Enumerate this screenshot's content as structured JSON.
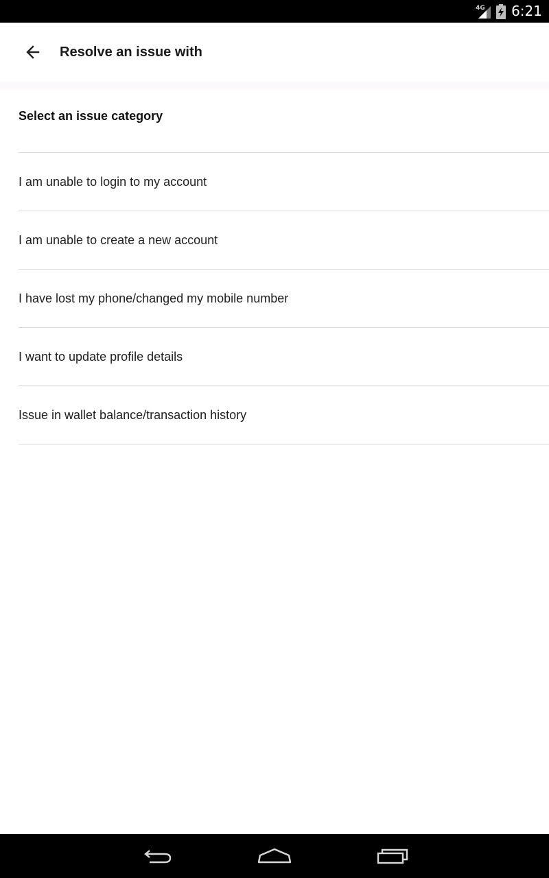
{
  "status_bar": {
    "network": "4G",
    "time": "6:21",
    "icons": [
      "signal-icon",
      "battery-charging-icon"
    ]
  },
  "app_bar": {
    "back_icon": "arrow-left-icon",
    "title": "Resolve an issue with"
  },
  "content": {
    "section_title": "Select an issue category",
    "issues": [
      {
        "label": "I am unable to login to my account"
      },
      {
        "label": "I am unable to create a new account"
      },
      {
        "label": "I have lost my phone/changed my mobile number"
      },
      {
        "label": "I want to update profile details"
      },
      {
        "label": "Issue in wallet balance/transaction history"
      }
    ]
  },
  "nav_bar": {
    "icons": [
      "nav-back-icon",
      "nav-home-icon",
      "nav-recents-icon"
    ]
  },
  "colors": {
    "status_bar_bg": "#000000",
    "background": "#ffffff",
    "divider": "#d9d9d9",
    "text": "#1f1f1f"
  }
}
